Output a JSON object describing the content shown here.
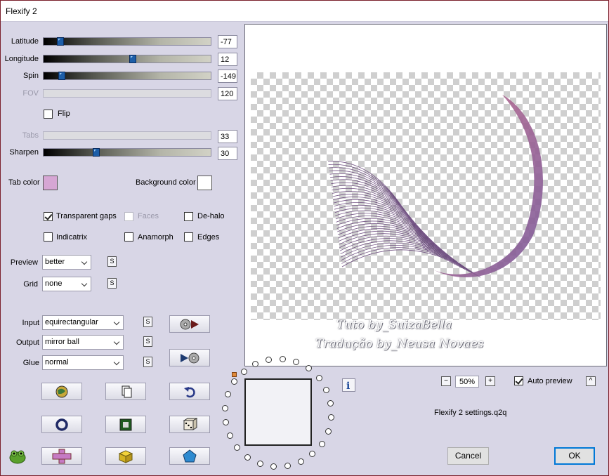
{
  "window": {
    "title": "Flexify 2"
  },
  "sliders": [
    {
      "label": "Latitude",
      "value": "-77",
      "level": 0.09,
      "enabled": true
    },
    {
      "label": "Longitude",
      "value": "12",
      "level": 0.53,
      "enabled": true
    },
    {
      "label": "Spin",
      "value": "-149",
      "level": 0.1,
      "enabled": true
    },
    {
      "label": "FOV",
      "value": "120",
      "enabled": false
    }
  ],
  "flip": {
    "label": "Flip",
    "checked": false
  },
  "tabs": {
    "label": "Tabs",
    "value": "33",
    "enabled": false
  },
  "sharpen": {
    "label": "Sharpen",
    "value": "30",
    "level": 0.31
  },
  "colors": {
    "tab_label": "Tab color",
    "tab_color": "#d6a6d4",
    "background_label": "Background color",
    "background_color": "#ffffff"
  },
  "options": {
    "transparent_gaps": "Transparent gaps",
    "faces": "Faces",
    "de_halo": "De-halo",
    "indicatrix": "Indicatrix",
    "anamorph": "Anamorph",
    "edges": "Edges"
  },
  "preview_quality": {
    "label": "Preview",
    "value": "better"
  },
  "grid": {
    "label": "Grid",
    "value": "none"
  },
  "input": {
    "label": "Input",
    "value": "equirectangular"
  },
  "output": {
    "label": "Output",
    "value": "mirror ball"
  },
  "glue": {
    "label": "Glue",
    "value": "normal"
  },
  "s_label": "S",
  "watermark": {
    "line1": "Tuto by_SuizaBella",
    "line2": "Tradução by_Neusa Novaes"
  },
  "zoom": {
    "value": "50%",
    "minus": "−",
    "plus": "+"
  },
  "auto_preview": {
    "label": "Auto preview",
    "checked": true
  },
  "collapse_label": "^",
  "settings_file": "Flexify 2 settings.q2q",
  "info_label": "i",
  "buttons": {
    "cancel": "Cancel",
    "ok": "OK"
  },
  "accent_color": "#0078d7"
}
